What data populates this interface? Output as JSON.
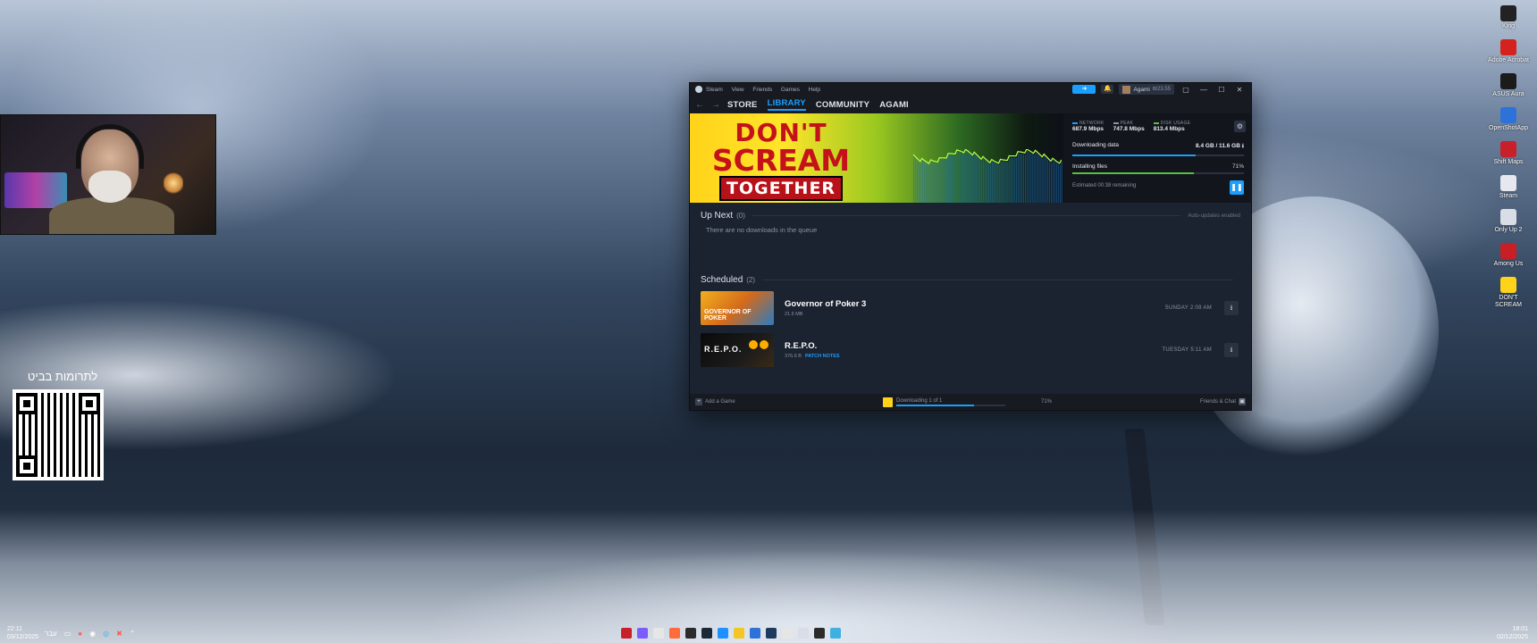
{
  "desktop": {
    "donation_label": "לתרומות בביט",
    "icons": [
      {
        "label": "Kirig",
        "color": "#222222"
      },
      {
        "label": "Adobe Acrobat",
        "color": "#d4221c"
      },
      {
        "label": "ASUS Aura",
        "color": "#1b1b1b"
      },
      {
        "label": "OpenShotApp",
        "color": "#2d72d9"
      },
      {
        "label": "Shift Maps",
        "color": "#c8202a"
      },
      {
        "label": "Steam",
        "color": "#e5e9ef"
      },
      {
        "label": "Only Up 2",
        "color": "#d8dde6"
      },
      {
        "label": "Among Us",
        "color": "#c81e25"
      },
      {
        "label": "DON'T SCREAM",
        "color": "#ffd31a"
      }
    ]
  },
  "steam": {
    "titlebar": {
      "menu": [
        "Steam",
        "View",
        "Friends",
        "Games",
        "Help"
      ],
      "user_name": "Agami",
      "user_balance": "₪23.55",
      "min": "—",
      "max": "☐",
      "close": "✕"
    },
    "nav": {
      "store": "STORE",
      "library": "LIBRARY",
      "community": "COMMUNITY",
      "user": "AGAMI"
    },
    "hero": {
      "game_title_line1": "DON'T",
      "game_title_line2": "SCREAM",
      "game_title_line3": "TOGETHER",
      "network_label": "NETWORK",
      "network_value": "687.9 Mbps",
      "peak_label": "PEAK",
      "peak_value": "747.8 Mbps",
      "disk_label": "DISK USAGE",
      "disk_value": "813.4 Mbps",
      "downloading_label": "Downloading data",
      "downloading_value": "8.4 GB / 11.6 GB",
      "downloading_progress": 0.72,
      "installing_label": "Installing files",
      "installing_value": "71%",
      "installing_progress": 0.71,
      "estimated": "Estimated 00:38 remaining",
      "colors": {
        "network": "#1a9fff",
        "peak": "#8b93a0",
        "disk": "#59bf40"
      }
    },
    "up_next": {
      "title": "Up Next",
      "count": "(0)",
      "auto_updates": "Auto-updates enabled",
      "empty_message": "There are no downloads in the queue"
    },
    "scheduled": {
      "title": "Scheduled",
      "count": "(2)",
      "items": [
        {
          "name": "Governor of Poker 3",
          "size": "21.6 MB",
          "patch_notes": "",
          "when": "SUNDAY 2:09 AM",
          "thumb_text": "GOVERNOR OF POKER"
        },
        {
          "name": "R.E.P.O.",
          "size": "376.6 B",
          "patch_notes": "PATCH NOTES",
          "when": "TUESDAY 5:11 AM",
          "thumb_text": "R.E.P.O."
        }
      ]
    },
    "footer": {
      "add_game": "Add a Game",
      "downloading": "Downloading 1 of 1",
      "downloading_progress": 0.71,
      "percent": "71%",
      "friends": "Friends & Chat"
    }
  },
  "taskbar": {
    "time_left": "22:11",
    "date_left": "03/12/2025",
    "lang": "עבר",
    "time_right": "18:01",
    "date_right": "02/12/2025"
  }
}
